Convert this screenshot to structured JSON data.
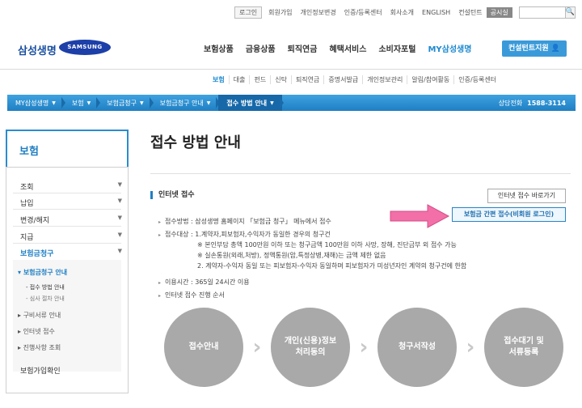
{
  "util": {
    "items": [
      "로그인",
      "회원가입",
      "개인정보변경",
      "인증/등록센터",
      "회사소개",
      "ENGLISH",
      "컨설턴트",
      "공시실"
    ],
    "search_btn": "🔍"
  },
  "brand": {
    "logo": "삼성생명",
    "samsung": "SAMSUNG"
  },
  "gnb": [
    "보험상품",
    "금융상품",
    "퇴직연금",
    "혜택서비스",
    "소비자포털",
    "MY삼성생명"
  ],
  "consult_btn": "컨설턴트지원 👤",
  "subnav": [
    "보험",
    "대출",
    "펀드",
    "신탁",
    "퇴직연금",
    "증명서발급",
    "개인정보관리",
    "알림/참여활동",
    "인증/등록센터"
  ],
  "breadcrumb": {
    "items": [
      "MY삼성생명",
      "보험",
      "보험금청구",
      "보험금청구 안내",
      "접수 방법 안내"
    ],
    "phone_label": "상담전화",
    "phone": "1588-3114"
  },
  "lnb": {
    "title": "보험",
    "items": [
      "조회",
      "납입",
      "변경/해지",
      "지급",
      "보험금청구"
    ],
    "sub": [
      "보험금청구 안내",
      "접수 방법 안내",
      "심사 절차 안내",
      "구비서류 안내",
      "인터넷 접수",
      "진행사항 조회"
    ],
    "last": "보험가입확인"
  },
  "main": {
    "title": "접수 방법 안내",
    "section": "인터넷 접수",
    "btn_shortcut": "인터넷 접수 바로가기",
    "btn_simple": "보험금 간편 접수(비회원 로그인)",
    "lines": [
      "접수방법 : 삼성생명 홈페이지 「보험금 청구」 메뉴에서 접수",
      "접수대상 : 1.계약자,피보험자,수익자가 동일한 경우의 청구건",
      "※ 본인부담 총액 100만원 이하 또는 청구금액 100만원 이하 사망, 장해, 진단금부 외 접수 가능",
      "※ 실손통원(외래,처방), 정액통원(암,특정상병,재해)는 금액 제한 없음",
      "2. 계약자-수익자 동일 또는 피보험자-수익자 동일하며 피보험자가 미성년자인 계약의 청구건에 한함",
      "이용시간 : 365일 24시간 이용",
      "인터넷 접수 진행 순서"
    ],
    "steps": [
      "접수안내",
      "개인(신용)정보\n처리동의",
      "청구서작성",
      "접수대기 및\n서류등록"
    ]
  },
  "colors": {
    "accent": "#1f7fc3",
    "arrow": "#f36fa7"
  }
}
